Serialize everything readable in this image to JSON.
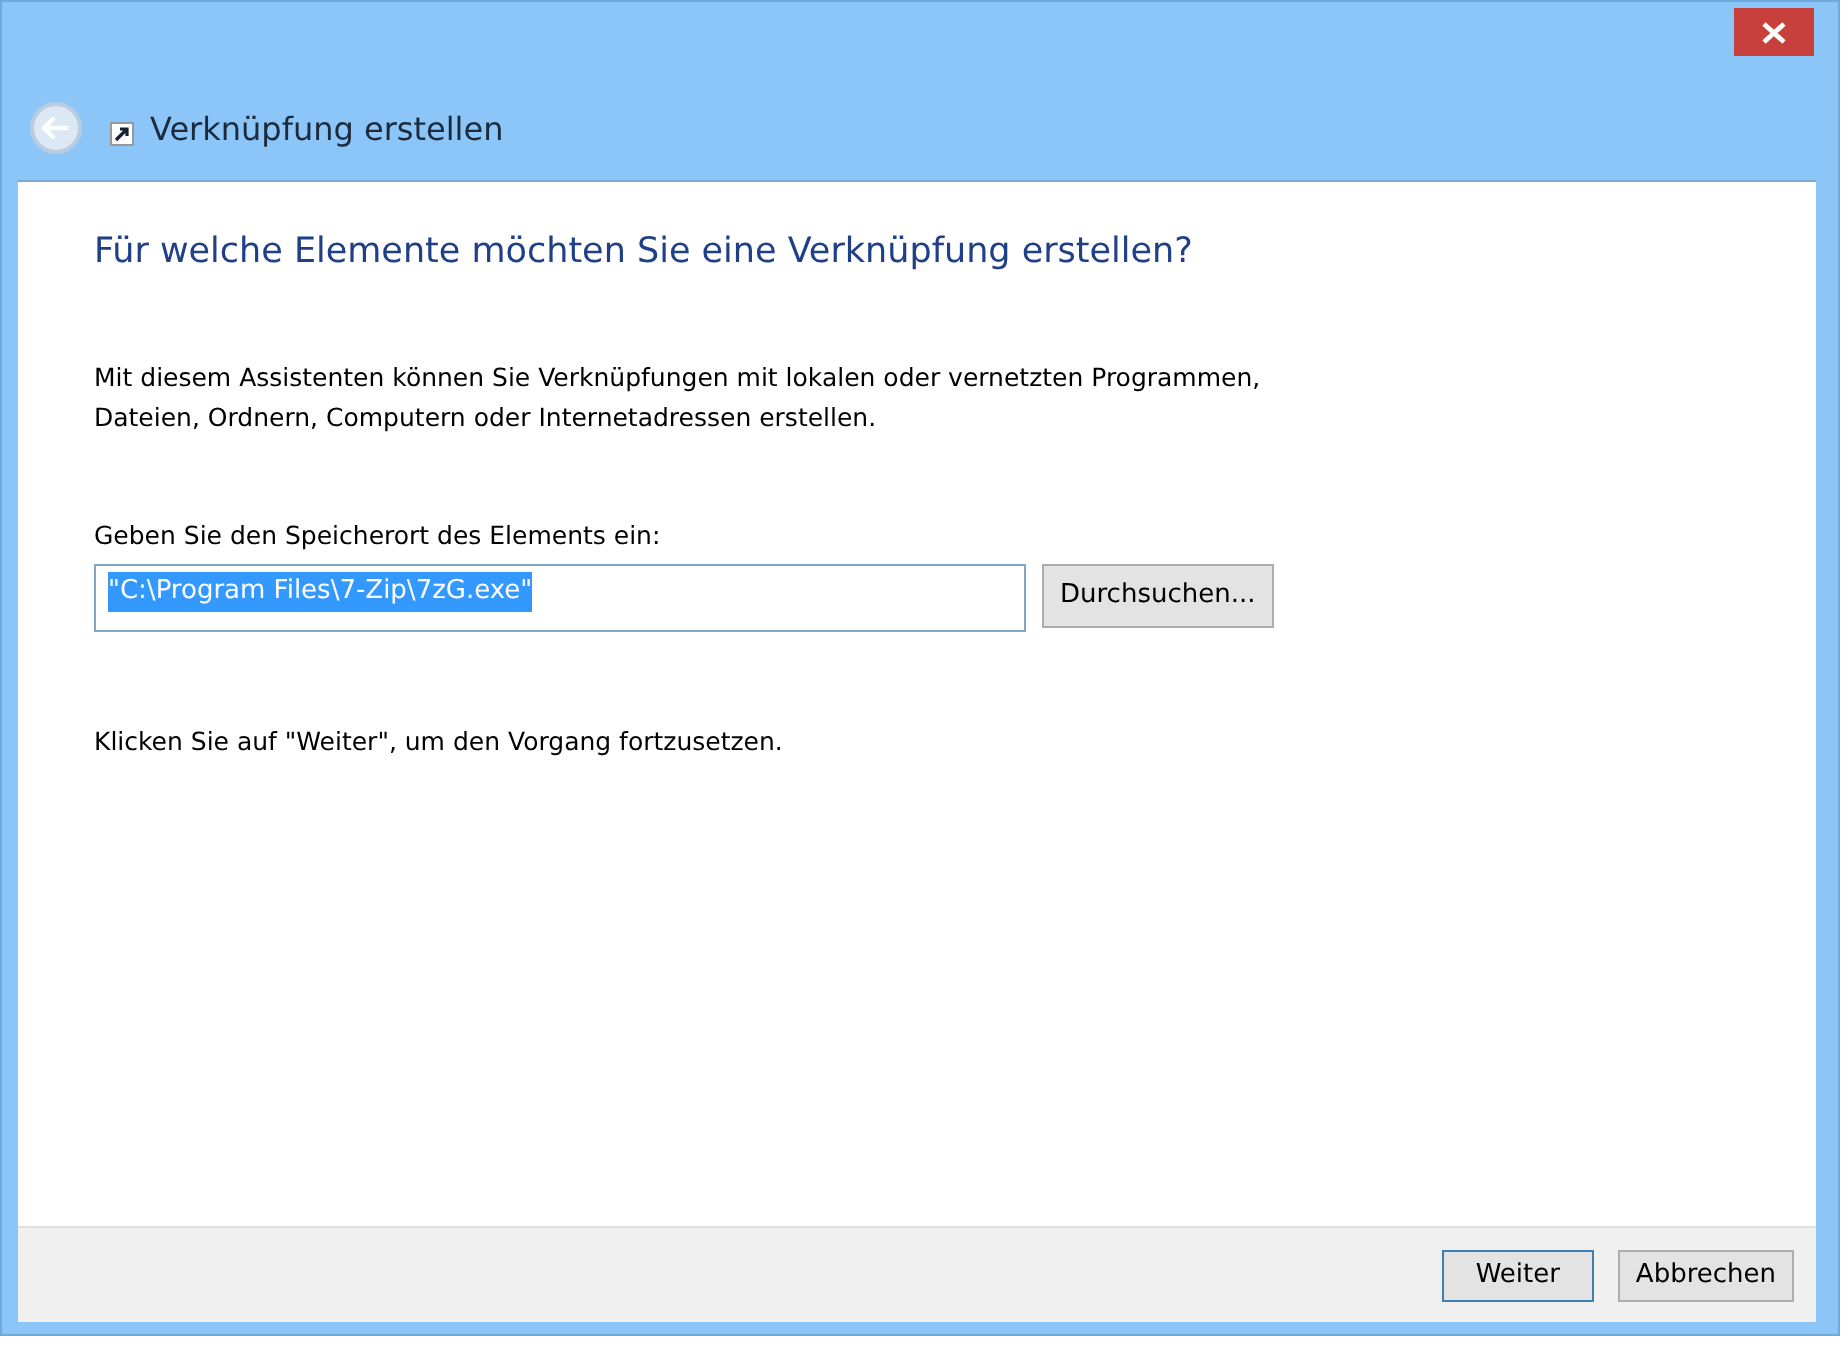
{
  "window": {
    "title": "Verknüpfung erstellen"
  },
  "heading": "Für welche Elemente möchten Sie eine Verknüpfung erstellen?",
  "description": "Mit diesem Assistenten können Sie Verknüpfungen mit lokalen oder vernetzten Programmen, Dateien, Ordnern, Computern oder Internetadressen erstellen.",
  "location": {
    "label": "Geben Sie den Speicherort des Elements ein:",
    "value": "\"C:\\Program Files\\7-Zip\\7zG.exe\"",
    "text_selected": true,
    "browse_button": "Durchsuchen..."
  },
  "hint": "Klicken Sie auf \"Weiter\", um den Vorgang fortzusetzen.",
  "buttons": [
    {
      "label": "Weiter",
      "default": true
    },
    {
      "label": "Abbrechen",
      "default": false
    }
  ]
}
